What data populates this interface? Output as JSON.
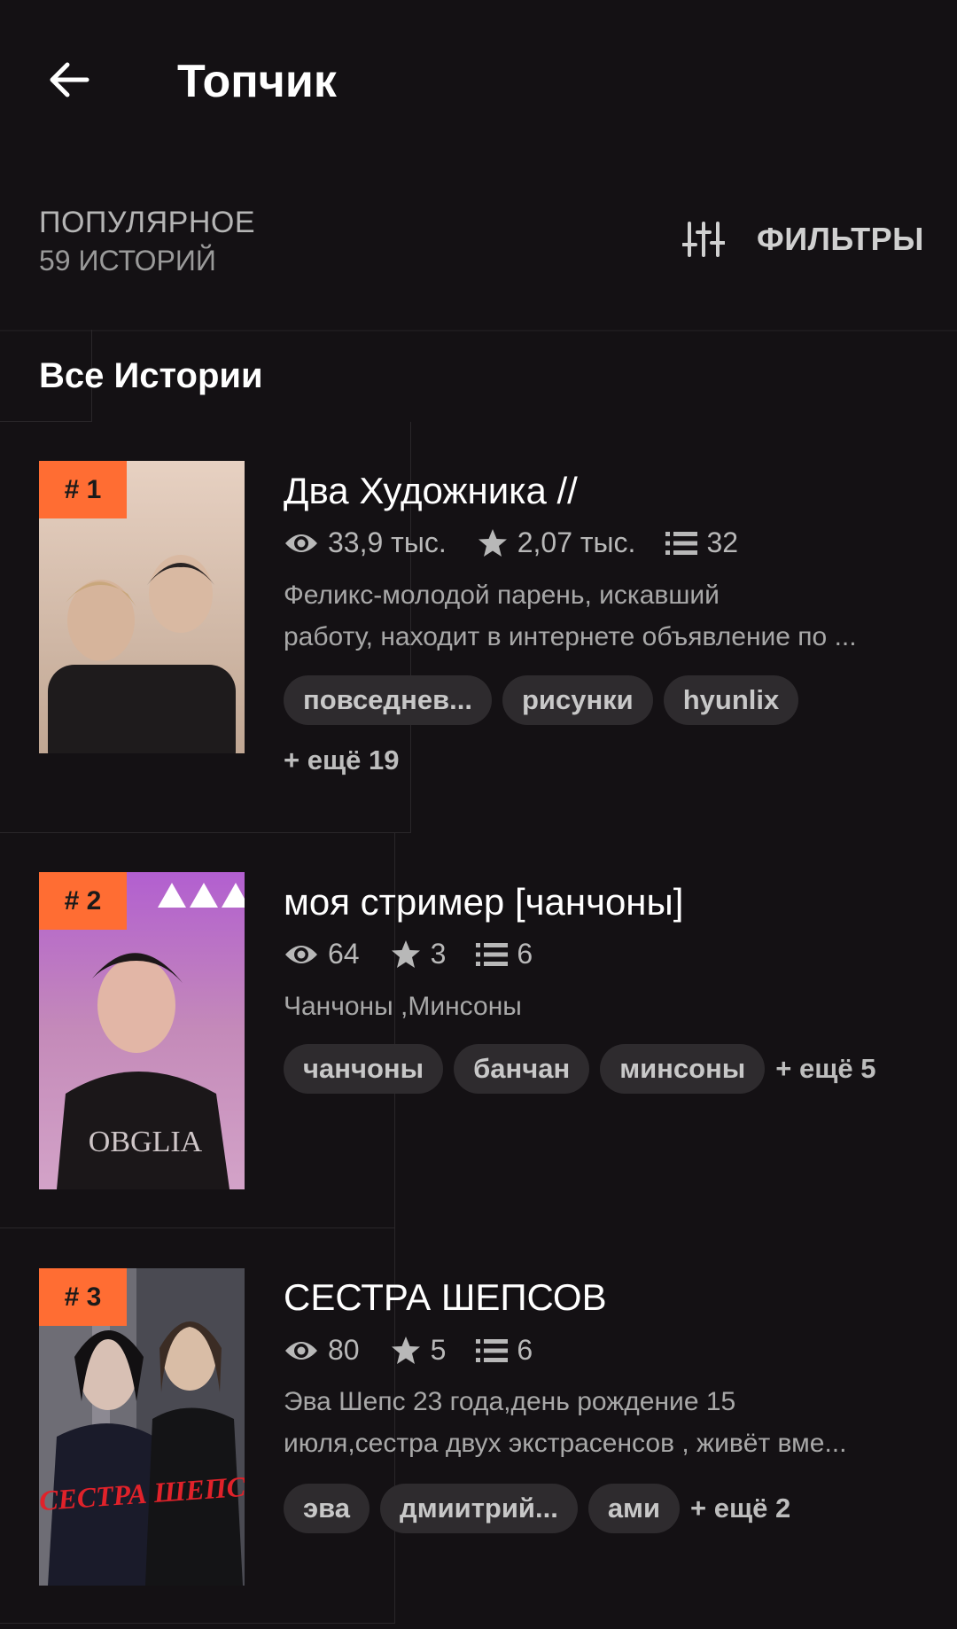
{
  "header": {
    "title": "Топчик"
  },
  "section": {
    "sort_label": "ПОПУЛЯРНОЕ",
    "count_label": "59 ИСТОРИЙ",
    "filter_label": "ФИЛЬТРЫ"
  },
  "tabs": {
    "all_label": "Все Истории"
  },
  "colors": {
    "background": "#141114",
    "rank_badge": "#ff6d33",
    "tag_bg": "#2e2b2e"
  },
  "stories": [
    {
      "rank": "# 1",
      "title": "Два Художника //",
      "views": "33,9 тыс.",
      "votes": "2,07 тыс.",
      "parts": "32",
      "desc_line1": "Феликс-молодой парень, искавший",
      "desc_line2": "работу, находит в интернете объявление по ...",
      "tags": [
        "повседнев...",
        "рисунки",
        "hyunlix"
      ],
      "more": "+ ещё 19"
    },
    {
      "rank": "# 2",
      "title": "моя стример [чанчоны]",
      "views": "64",
      "votes": "3",
      "parts": "6",
      "desc_line1": "Чанчоны ,Минсоны",
      "tags": [
        "чанчоны",
        "банчан",
        "минсоны"
      ],
      "more": "+ ещё 5"
    },
    {
      "rank": "# 3",
      "title": "СЕСТРА ШЕПСОВ",
      "views": "80",
      "votes": "5",
      "parts": "6",
      "desc_line1": "Эва Шепс 23 года,день рождение 15",
      "desc_line2": "июля,сестра двух экстрасенсов , живёт вме...",
      "tags": [
        "эва",
        "дмиитрий...",
        "ами"
      ],
      "more": "+ ещё 2",
      "cover_text": "СЕСТРА ШЕПСОВ"
    }
  ]
}
